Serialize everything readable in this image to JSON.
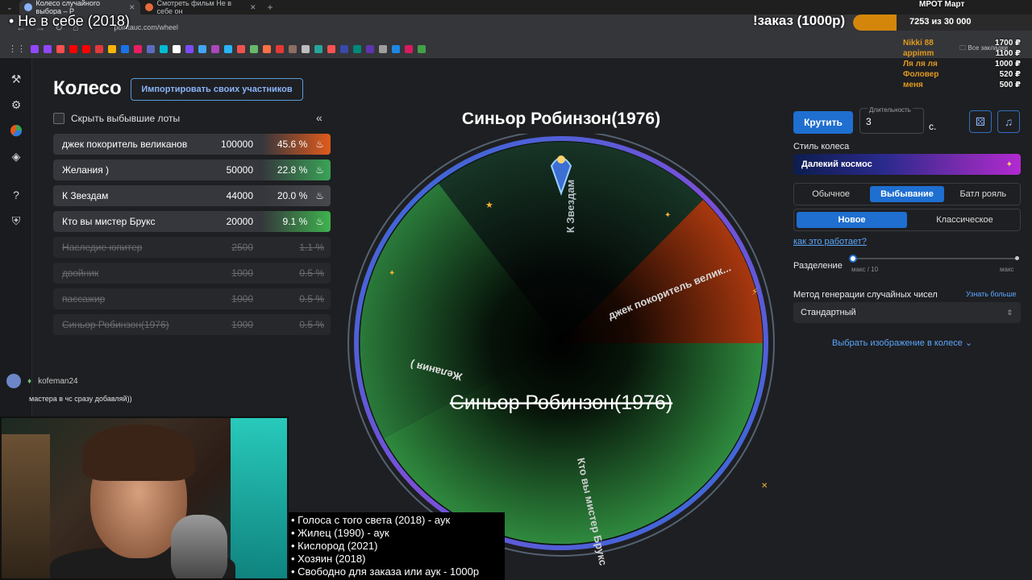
{
  "browser": {
    "tabs": [
      {
        "label": "Колесо случайного выбора – Р",
        "active": true
      },
      {
        "label": "Смотреть фильм Не в себе он",
        "active": false
      }
    ],
    "url": "pointauc.com/wheel",
    "bookmarks_folder": "Все закладки"
  },
  "overlay": {
    "stream_title": "• Не в себе (2018)",
    "order_label": "!заказ (1000р)",
    "goal_label": "МРОТ Март",
    "goal_progress_text": "7253  из 30 000",
    "goal_progress": 0.242,
    "donors": [
      {
        "name": "Nikki 88",
        "amount": "1700 ₽"
      },
      {
        "name": "appimm",
        "amount": "1100 ₽"
      },
      {
        "name": "Ля ля ля",
        "amount": "1000 ₽"
      },
      {
        "name": "Фоловер",
        "amount": "520 ₽"
      },
      {
        "name": "меня",
        "amount": "500 ₽"
      }
    ],
    "schedule": [
      "• Голоса с того света (2018) - аук",
      "• Жилец (1990) - аук",
      "• Кислород (2021)",
      "• Хозяин (2018)",
      "• Свободно для заказа или аук - 1000р"
    ],
    "chat_user": "kofeman24",
    "chat_message": "мастера в чс сразу добавляй))"
  },
  "page": {
    "title": "Колесо",
    "import_button": "Импортировать своих участников",
    "hide_label": "Скрыть выбывшие лоты",
    "collapse_icon": "«"
  },
  "lots": [
    {
      "name": "джек покоритель великанов",
      "amount": "100000",
      "percent": "45.6 %",
      "color": "#e05a1c",
      "out": false
    },
    {
      "name": "Желания )",
      "amount": "50000",
      "percent": "22.8 %",
      "color": "#3aa356",
      "out": false
    },
    {
      "name": "К Звездам",
      "amount": "44000",
      "percent": "20.0 %",
      "color": "#46484d",
      "out": false
    },
    {
      "name": "Кто вы мистер Брукс",
      "amount": "20000",
      "percent": "9.1 %",
      "color": "#3fb24e",
      "out": false
    },
    {
      "name": "Наследие юпитер",
      "amount": "2500",
      "percent": "1.1 %",
      "out": true
    },
    {
      "name": "двойник",
      "amount": "1000",
      "percent": "0.5 %",
      "out": true
    },
    {
      "name": "пассажир",
      "amount": "1000",
      "percent": "0.5 %",
      "out": true
    },
    {
      "name": "Синьор Робинзон(1976)",
      "amount": "1000",
      "percent": "0.5 %",
      "out": true
    }
  ],
  "wheel": {
    "winner_title": "Синьор Робинзон(1976)",
    "center_text": "Синьор Робинзон(1976)",
    "segment_labels": {
      "top": "К Звездам",
      "right": "джек покоритель велик...",
      "left": "Желания )",
      "bottom": "Кто вы мистер Брукс"
    },
    "colors": {
      "green": "#2f8a3e",
      "orange": "#a8380f",
      "dark": "#1a3328",
      "rim": "#5a6fd6"
    }
  },
  "controls": {
    "spin_button": "Крутить",
    "duration_label": "Длительность",
    "duration_value": "3",
    "duration_unit": "с.",
    "wheel_style_label": "Стиль колеса",
    "wheel_style_value": "Далекий космос",
    "modes": [
      "Обычное",
      "Выбывание",
      "Батл рояль"
    ],
    "active_mode": "Выбывание",
    "variants": [
      "Новое",
      "Классическое"
    ],
    "active_variant": "Новое",
    "how_link": "как это работает?",
    "split_label": "Разделение",
    "split_min_label": "макс / 10",
    "split_max_label": "макс",
    "split_value": 0,
    "rng_label": "Метод генерации случайных чисел",
    "rng_more": "Узнать больше",
    "rng_value": "Стандартный",
    "pick_image": "Выбрать изображение в колесе"
  }
}
